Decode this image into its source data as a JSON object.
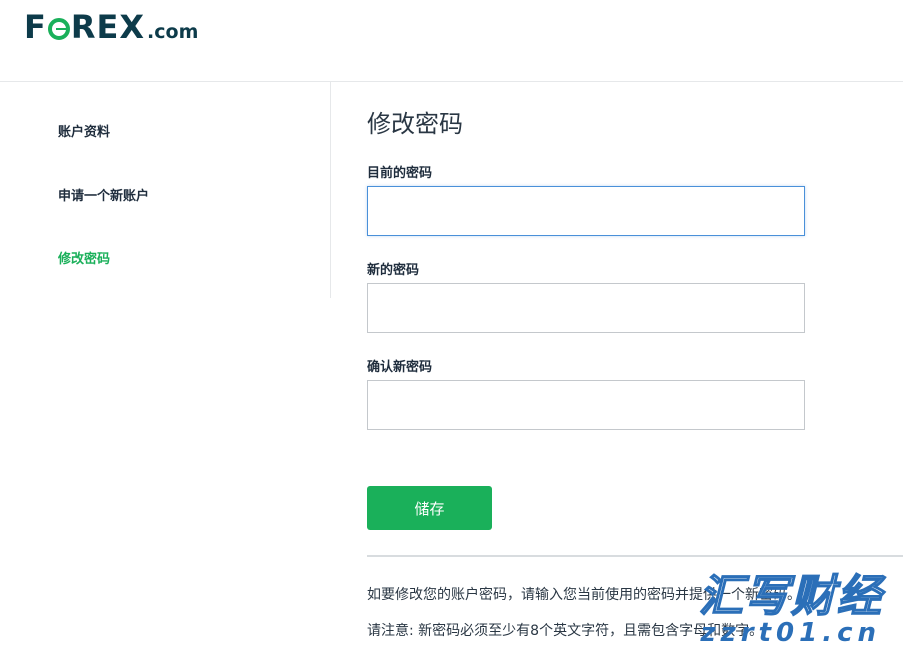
{
  "brand": {
    "logo_text_prefix": "F",
    "logo_text_suffix": "REX",
    "logo_domain": ".com",
    "accent_color": "#1ab05a",
    "primary_text_color": "#0d3b4a"
  },
  "sidebar": {
    "items": [
      {
        "label": "账户资料",
        "active": false
      },
      {
        "label": "申请一个新账户",
        "active": false
      },
      {
        "label": "修改密码",
        "active": true
      }
    ]
  },
  "main": {
    "title": "修改密码",
    "fields": [
      {
        "label": "目前的密码",
        "value": "",
        "placeholder": "",
        "focused": true
      },
      {
        "label": "新的密码",
        "value": "",
        "placeholder": "",
        "focused": false
      },
      {
        "label": "确认新密码",
        "value": "",
        "placeholder": "",
        "focused": false
      }
    ],
    "save_label": "储存",
    "info_lines": [
      "如要修改您的账户密码，请输入您当前使用的密码并提供一个新密码。",
      "请注意: 新密码必须至少有8个英文字符，且需包含字母和数字。"
    ]
  },
  "watermark": {
    "top_text": "汇写财经",
    "bottom_text": "zzrt01.cn"
  }
}
